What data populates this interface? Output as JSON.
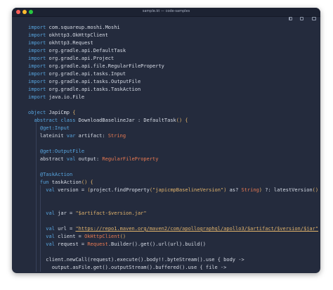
{
  "window": {
    "title": "sample.kt — code-samples",
    "controls": [
      "sidebar-toggle-icon",
      "split-view-icon",
      "fullscreen-icon"
    ],
    "colors": {
      "close": "#ff5f57",
      "minimize": "#febc2e",
      "zoom": "#28c840",
      "background": "#242b3d"
    }
  },
  "code": {
    "imports": [
      {
        "kw": "import",
        "path": "com.squareup.moshi.Moshi"
      },
      {
        "kw": "import",
        "path": "okhttp3.OkHttpClient"
      },
      {
        "kw": "import",
        "path": "okhttp3.Request"
      },
      {
        "kw": "import",
        "path": "org.gradle.api.DefaultTask"
      },
      {
        "kw": "import",
        "path": "org.gradle.api.Project"
      },
      {
        "kw": "import",
        "path": "org.gradle.api.file.RegularFileProperty"
      },
      {
        "kw": "import",
        "path": "org.gradle.api.tasks.Input"
      },
      {
        "kw": "import",
        "path": "org.gradle.api.tasks.OutputFile"
      },
      {
        "kw": "import",
        "path": "org.gradle.api.tasks.TaskAction"
      },
      {
        "kw": "import",
        "path": "java.io.File"
      }
    ],
    "object_decl": {
      "kw": "object",
      "name": "JapiCmp",
      "brace": "{"
    },
    "class_decl": {
      "kw1": "abstract",
      "kw2": "class",
      "name": "DownloadBaselineJar",
      "sep": " : ",
      "super": "DefaultTask",
      "parens": "()",
      "brace": "{"
    },
    "input_ann": "@get:Input",
    "artifact_decl": {
      "kw1": "lateinit",
      "kw2": "var",
      "name": "artifact",
      "colon": ": ",
      "type": "String"
    },
    "output_ann": "@get:OutputFile",
    "output_decl": {
      "kw1": "abstract",
      "kw2": "val",
      "name": "output",
      "colon": ": ",
      "type": "RegularFileProperty"
    },
    "task_ann": "@TaskAction",
    "fun_decl": {
      "kw": "fun",
      "name": "taskAction",
      "parens": "()",
      "brace": "{"
    },
    "version_line": {
      "kw": "val",
      "name": " version = ",
      "open": "(",
      "call": "project.findProperty",
      "popen": "(",
      "str": "\"japicmpBaselineVersion\"",
      "pclose": ")",
      "as": " as? ",
      "type": "String",
      "close": ")",
      "rest": " ?: latestVersion",
      "parens": "()"
    },
    "jar_line": {
      "kw": "val",
      "name": " jar = ",
      "str": "\"$artifact-$version.jar\""
    },
    "url_line": {
      "kw": "val",
      "name": " url = ",
      "str": "\"https://repo1.maven.org/maven2/com/apollographql/apollo3/$artifact/$version/$jar\""
    },
    "client_line": {
      "kw": "val",
      "name": " client = ",
      "type": "OkHttpClient",
      "parens": "()"
    },
    "request_line": {
      "kw": "val",
      "name": " request = ",
      "type": "Request",
      "rest": ".Builder().get().url(url).build()"
    },
    "call_line": "client.newCall(request).execute().body!!.byteStream().use { body ->",
    "output_line": "output.asFile.get().outputStream().buffered().use { file ->"
  }
}
